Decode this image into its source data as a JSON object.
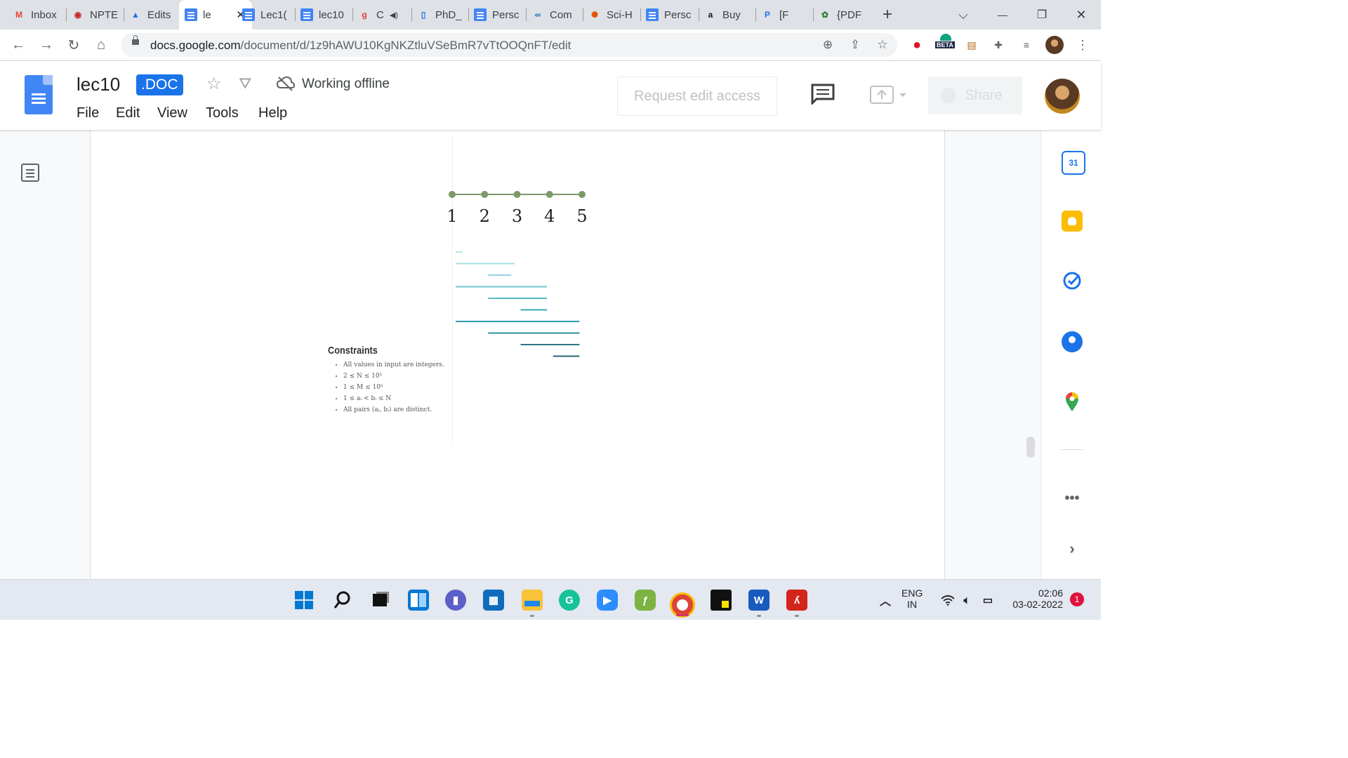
{
  "browser": {
    "tabs": [
      {
        "label": "Inbox",
        "icon": "gmail-icon"
      },
      {
        "label": "NPTE",
        "icon": "nptel-icon"
      },
      {
        "label": "Edits",
        "icon": "drive-icon"
      },
      {
        "label": "le",
        "icon": "docs-icon",
        "active": true
      },
      {
        "label": "Lec1(",
        "icon": "docs-icon"
      },
      {
        "label": "lec10",
        "icon": "docs-icon"
      },
      {
        "label": "C",
        "icon": "g-icon"
      },
      {
        "label": "PhD_",
        "icon": "file-icon"
      },
      {
        "label": "Persc",
        "icon": "docs-icon"
      },
      {
        "label": "Com",
        "icon": "link-icon"
      },
      {
        "label": "Sci-H",
        "icon": "scihub-icon"
      },
      {
        "label": "Persc",
        "icon": "docs-icon"
      },
      {
        "label": "Buy",
        "icon": "amazon-icon"
      },
      {
        "label": "[F",
        "icon": "book-icon"
      },
      {
        "label": "{PDF",
        "icon": "pdf-icon"
      }
    ],
    "url_host": "docs.google.com",
    "url_path": "/document/d/1z9hAWU10KgNKZtluVSeBmR7vTtOOQnFT/edit",
    "beta_badge": "BETA"
  },
  "docs": {
    "title": "lec10",
    "badge": ".DOC",
    "status": "Working offline",
    "menu": [
      "File",
      "Edit",
      "View",
      "Tools",
      "Help"
    ],
    "request_button": "Request edit access",
    "share_button": "Share"
  },
  "content": {
    "number_labels": [
      "1",
      "2",
      "3",
      "4",
      "5"
    ],
    "constraints_title": "Constraints",
    "constraints": [
      "All values in input are integers.",
      "2 ≤ N ≤ 10⁵",
      "1 ≤ M ≤ 10⁵",
      "1 ≤ aᵢ < bᵢ ≤ N",
      "All pairs (aᵢ, bᵢ) are distinct."
    ],
    "intervals": [
      [
        1,
        1.3
      ],
      [
        1,
        2.9
      ],
      [
        2,
        2.8
      ],
      [
        1,
        3.9
      ],
      [
        2,
        3.9
      ],
      [
        3,
        3.9
      ],
      [
        1,
        4.9
      ],
      [
        2,
        4.9
      ],
      [
        3,
        4.9
      ],
      [
        4,
        4.9
      ]
    ]
  },
  "side_panel": {
    "calendar_day": "31"
  },
  "taskbar": {
    "lang_top": "ENG",
    "lang_bottom": "IN",
    "time": "02:06",
    "date": "03-02-2022",
    "notification_count": "1"
  },
  "colors": {
    "accent": "#1a73e8",
    "dot": "#7a9a6a"
  }
}
